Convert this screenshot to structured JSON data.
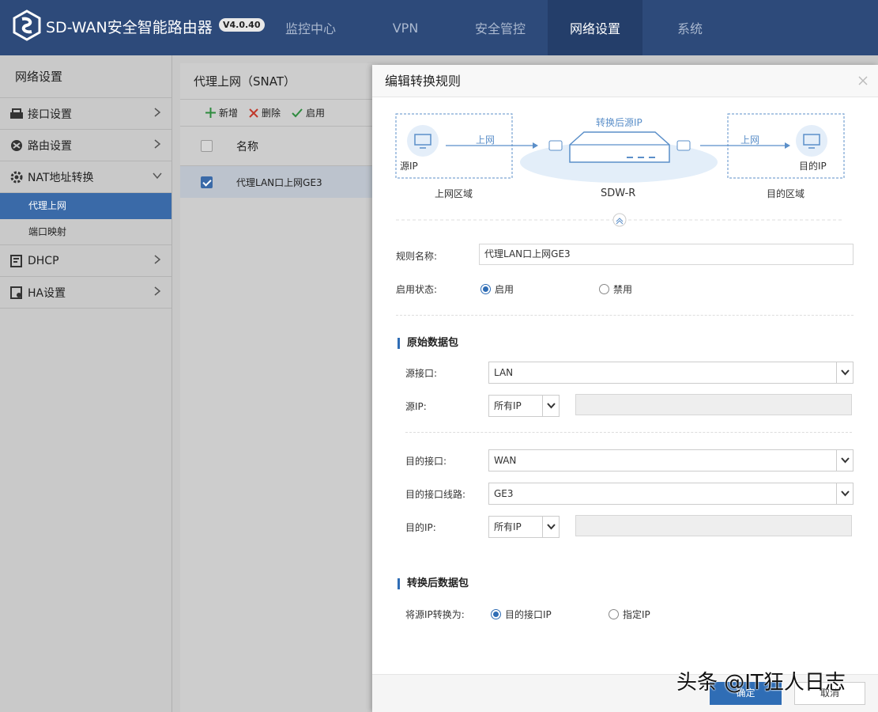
{
  "header": {
    "brand": "SD-WAN安全智能路由器",
    "version": "V4.0.40",
    "nav": [
      "监控中心",
      "VPN",
      "安全管控",
      "网络设置",
      "系统"
    ]
  },
  "sidebar": {
    "title": "网络设置",
    "items": [
      {
        "label": "接口设置",
        "icon": "interface-icon"
      },
      {
        "label": "路由设置",
        "icon": "route-icon"
      },
      {
        "label": "NAT地址转换",
        "icon": "gear-icon"
      },
      {
        "label": "DHCP",
        "icon": "dhcp-icon"
      },
      {
        "label": "HA设置",
        "icon": "ha-icon"
      }
    ],
    "subitems": [
      "代理上网",
      "端口映射"
    ]
  },
  "main": {
    "title": "代理上网（SNAT）",
    "toolbar": {
      "add": "新增",
      "delete": "删除",
      "enable": "启用"
    },
    "col_name": "名称",
    "rows": [
      "代理LAN口上网GE3"
    ]
  },
  "modal": {
    "title": "编辑转换规则",
    "diagram": {
      "src_ip": "源IP",
      "up1": "上网",
      "converted": "转换后源IP",
      "router": "SDW-R",
      "up2": "上网",
      "dst_ip": "目的IP",
      "src_zone": "上网区域",
      "dst_zone": "目的区域"
    },
    "rule_name_label": "规则名称:",
    "rule_name_value": "代理LAN口上网GE3",
    "status_label": "启用状态:",
    "status_on": "启用",
    "status_off": "禁用",
    "orig_section": "原始数据包",
    "src_if_label": "源接口:",
    "src_if_value": "LAN",
    "src_ip_label": "源IP:",
    "src_ip_value": "所有IP",
    "dst_if_label": "目的接口:",
    "dst_if_value": "WAN",
    "dst_line_label": "目的接口线路:",
    "dst_line_value": "GE3",
    "dst_ip_label": "目的IP:",
    "dst_ip_value": "所有IP",
    "conv_section": "转换后数据包",
    "conv_label": "将源IP转换为:",
    "conv_opt1": "目的接口IP",
    "conv_opt2": "指定IP",
    "ok": "确定",
    "cancel": "取消"
  },
  "watermark": "头条 @IT狂人日志"
}
